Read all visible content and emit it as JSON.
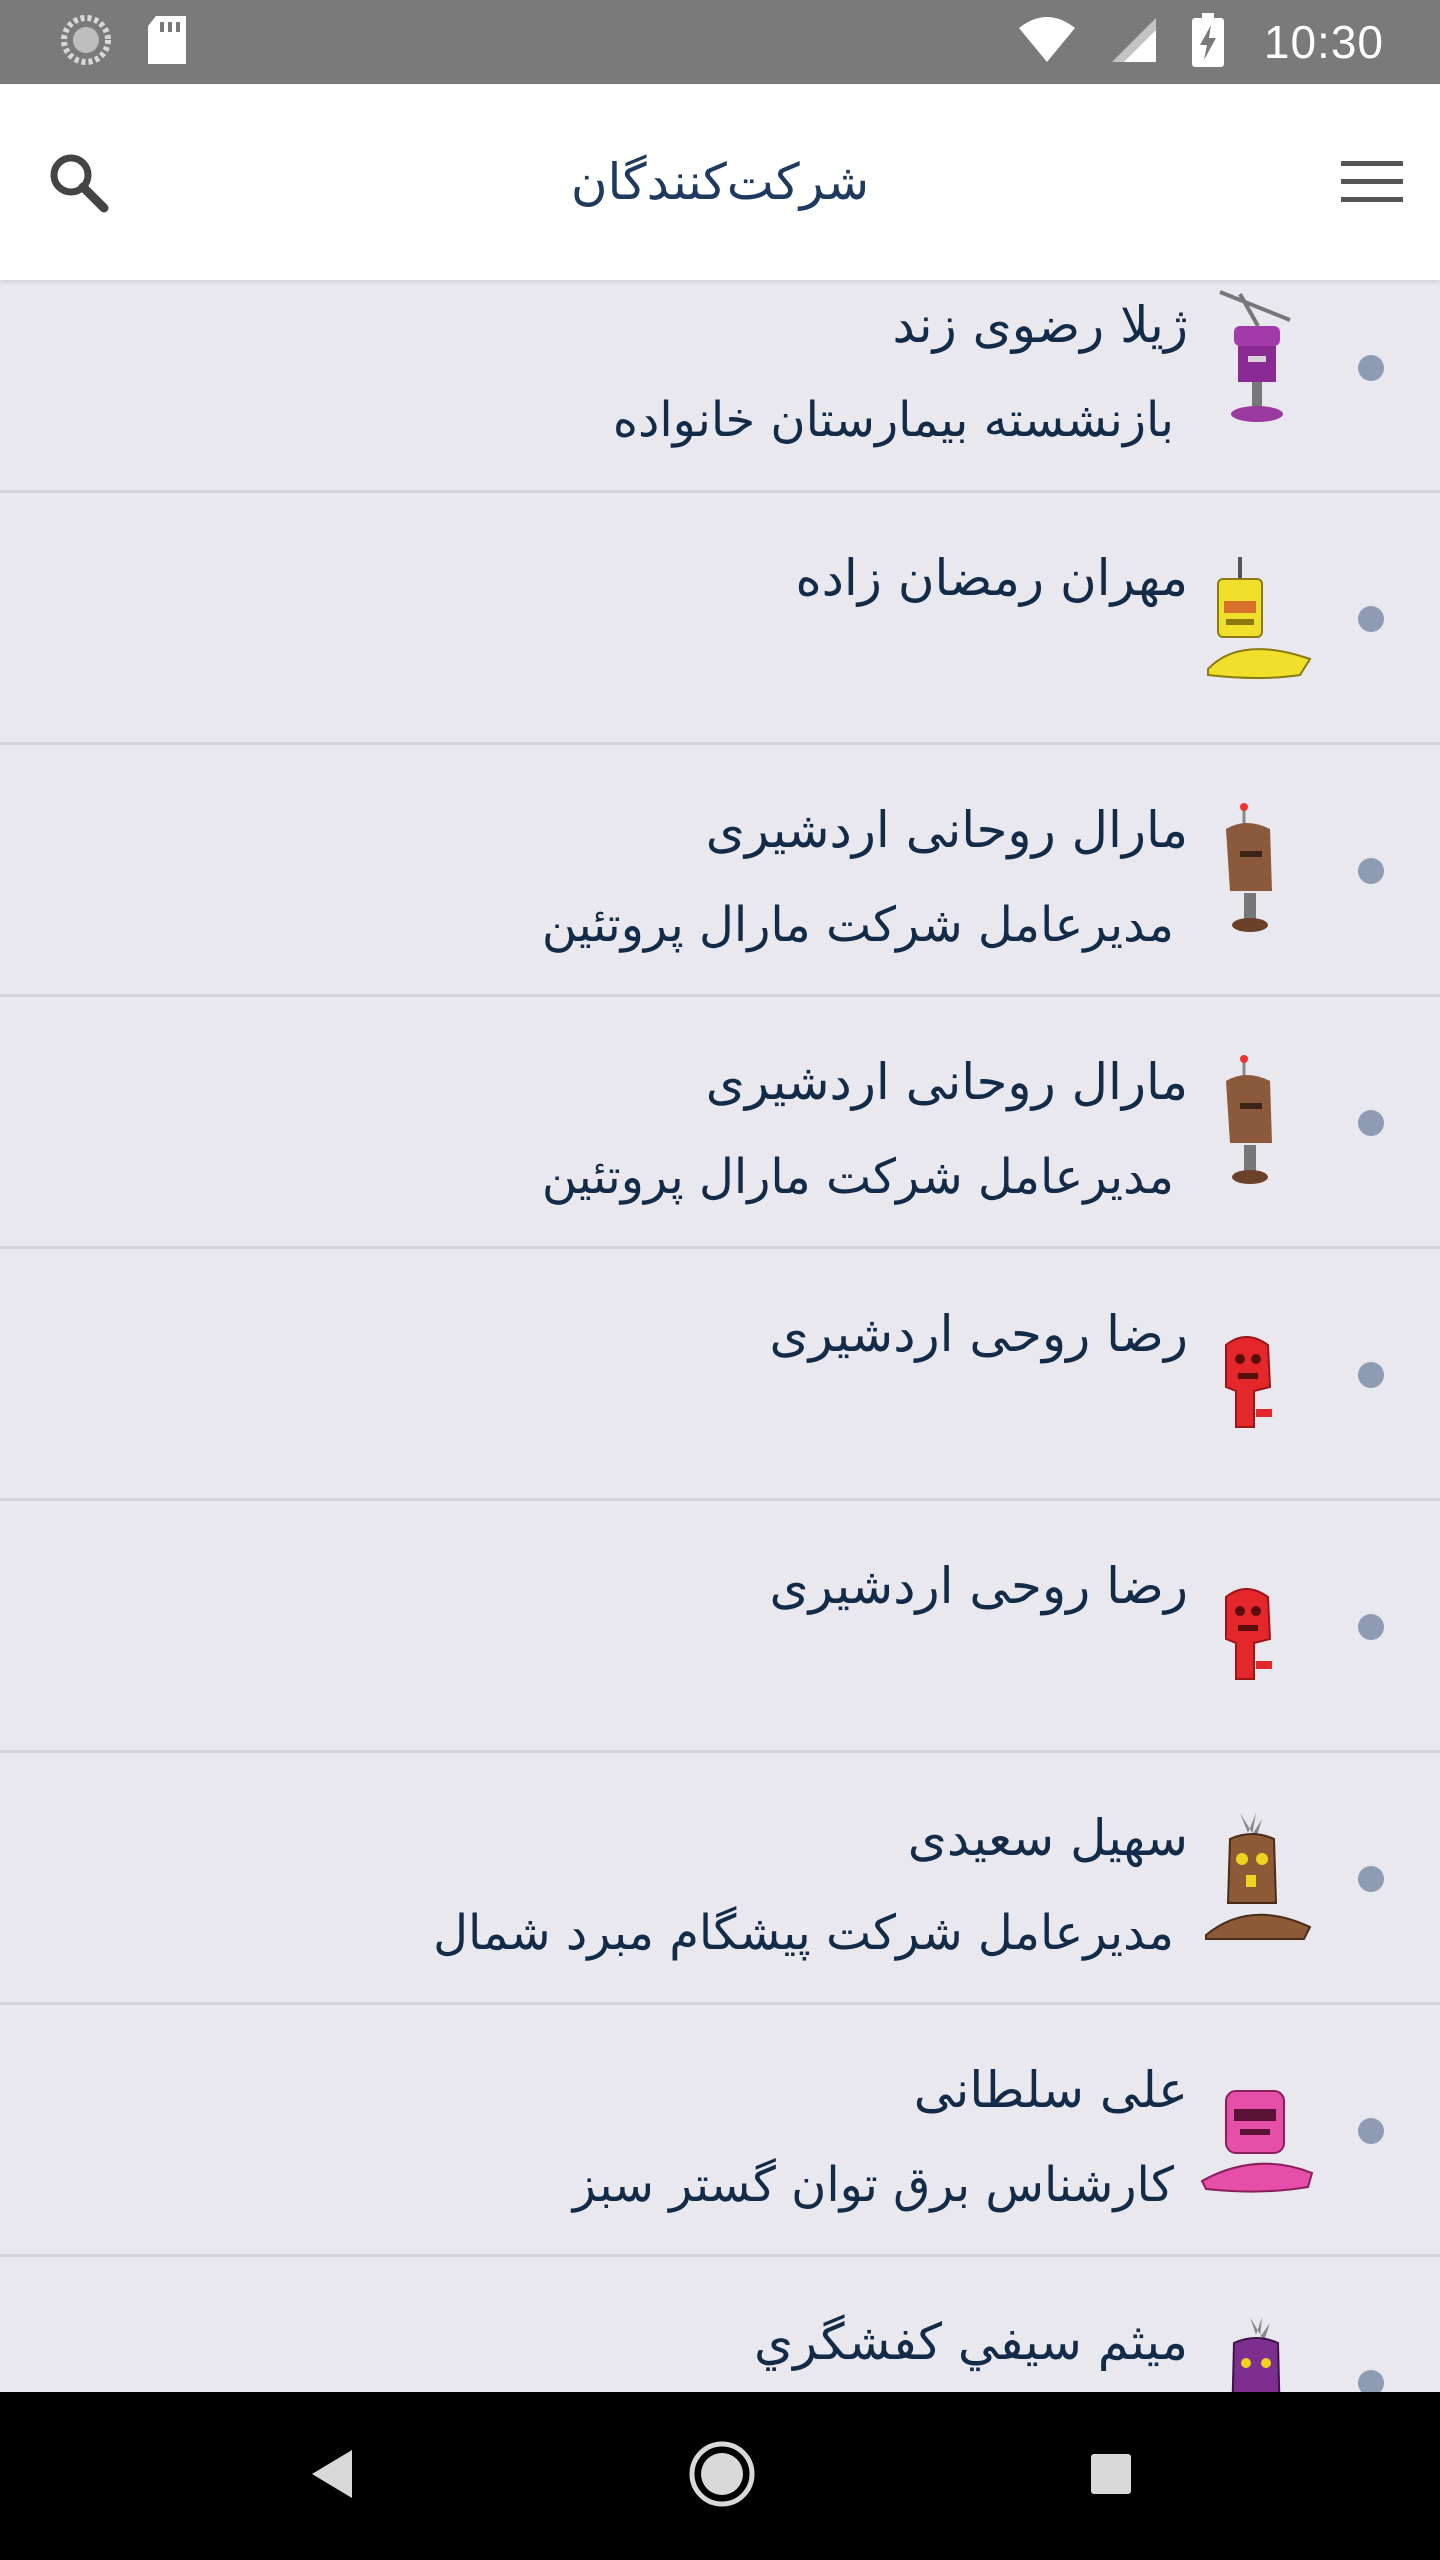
{
  "status_bar": {
    "time": "10:30",
    "icons": [
      "loading-circle-icon",
      "sd-card-icon",
      "wifi-icon",
      "cell-signal-icon",
      "battery-charging-icon"
    ]
  },
  "header": {
    "title": "شرکت‌کنندگان",
    "search_icon": "search-icon",
    "menu_icon": "hamburger-menu-icon"
  },
  "participants": [
    {
      "name": "ژیلا رضوی زند",
      "subtitle": "بازنشسته  بیمارستان خانواده",
      "avatar": "purple-antenna-robot-icon",
      "avatar_color": "#8a2a93"
    },
    {
      "name": "مهران  رمضان زاده",
      "subtitle": "",
      "avatar": "yellow-robot-icon",
      "avatar_color": "#f0e02c"
    },
    {
      "name": "مارال روحانی اردشیری",
      "subtitle": "مدیرعامل شرکت مارال پروتئین",
      "avatar": "brown-robot-icon",
      "avatar_color": "#8b5a3c"
    },
    {
      "name": "مارال روحانی اردشیری",
      "subtitle": "مدیرعامل شرکت مارال پروتئین",
      "avatar": "brown-robot-icon",
      "avatar_color": "#8b5a3c"
    },
    {
      "name": "رضا روحی اردشیری",
      "subtitle": "",
      "avatar": "red-robot-icon",
      "avatar_color": "#e3272b"
    },
    {
      "name": "رضا روحی اردشیری",
      "subtitle": "",
      "avatar": "red-robot-icon",
      "avatar_color": "#e3272b"
    },
    {
      "name": "سهیل سعیدی",
      "subtitle": "مدیرعامل شرکت پیشگام مبرد شمال",
      "avatar": "brown-big-robot-icon",
      "avatar_color": "#8d5a37"
    },
    {
      "name": "علی سلطانی",
      "subtitle": "کارشناس برق توان گستر سبز",
      "avatar": "pink-robot-icon",
      "avatar_color": "#e54fa8"
    },
    {
      "name": "ميثم سيفي كفشگري",
      "subtitle": "",
      "avatar": "purple-robot-icon",
      "avatar_color": "#7c2f8f"
    }
  ],
  "nav_bar": {
    "back_icon": "back-triangle-icon",
    "home_icon": "home-circle-icon",
    "recents_icon": "recents-square-icon"
  }
}
